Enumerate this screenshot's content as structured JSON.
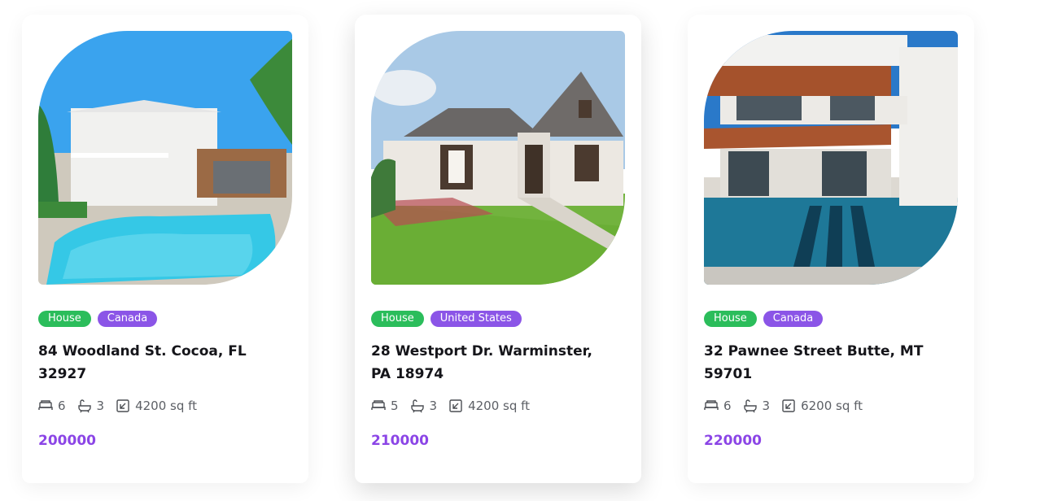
{
  "listings": [
    {
      "tags": [
        "House",
        "Canada"
      ],
      "address": "84 Woodland St. Cocoa, FL 32927",
      "beds": "6",
      "baths": "3",
      "area": "4200 sq ft",
      "price": "200000"
    },
    {
      "tags": [
        "House",
        "United States"
      ],
      "address": "28 Westport Dr. Warminster, PA 18974",
      "beds": "5",
      "baths": "3",
      "area": "4200 sq ft",
      "price": "210000"
    },
    {
      "tags": [
        "House",
        "Canada"
      ],
      "address": "32 Pawnee Street Butte, MT 59701",
      "beds": "6",
      "baths": "3",
      "area": "6200 sq ft",
      "price": "220000"
    }
  ],
  "colors": {
    "tag_type": "#2bbd5b",
    "tag_location": "#8b55e7",
    "price": "#8b45e6"
  },
  "icons": [
    "bed-icon",
    "bath-icon",
    "area-icon"
  ]
}
